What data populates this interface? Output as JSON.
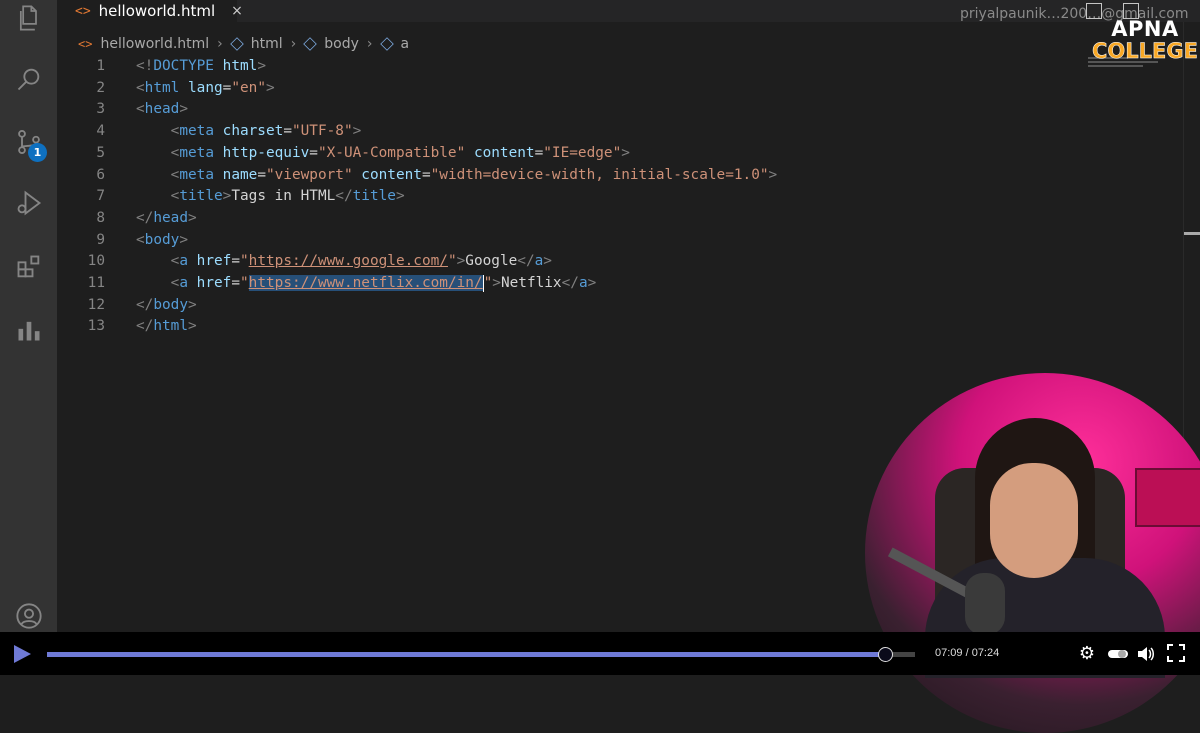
{
  "tab": {
    "file_icon": "<>",
    "filename": "helloworld.html",
    "close": "×"
  },
  "topright": {
    "text": "priyalpaunik…200…@gmail.com"
  },
  "breadcrumb": {
    "file_icon": "<>",
    "items": [
      "helloworld.html",
      "html",
      "body",
      "a"
    ]
  },
  "activity_bar": {
    "icons": [
      "explorer-icon",
      "search-icon",
      "source-control-icon",
      "run-debug-icon",
      "extensions-icon",
      "stats-icon",
      "account-icon"
    ],
    "source_control_badge": "1"
  },
  "logo": {
    "line1": "APNA",
    "line2": "COLLEGE"
  },
  "code_lines": [
    {
      "n": "1",
      "html": "<span class='bracket'>&lt;!</span><span class='tag'>DOCTYPE</span> <span class='attr'>html</span><span class='bracket'>&gt;</span>"
    },
    {
      "n": "2",
      "html": "<span class='bracket'>&lt;</span><span class='tag'>html</span> <span class='attr'>lang</span><span class='txt'>=</span><span class='str'>\"en\"</span><span class='bracket'>&gt;</span>"
    },
    {
      "n": "3",
      "html": "<span class='bracket'>&lt;</span><span class='tag'>head</span><span class='bracket'>&gt;</span>"
    },
    {
      "n": "4",
      "html": "    <span class='bracket'>&lt;</span><span class='tag'>meta</span> <span class='attr'>charset</span><span class='txt'>=</span><span class='str'>\"UTF-8\"</span><span class='bracket'>&gt;</span>"
    },
    {
      "n": "5",
      "html": "    <span class='bracket'>&lt;</span><span class='tag'>meta</span> <span class='attr'>http-equiv</span><span class='txt'>=</span><span class='str'>\"X-UA-Compatible\"</span> <span class='attr'>content</span><span class='txt'>=</span><span class='str'>\"IE=edge\"</span><span class='bracket'>&gt;</span>"
    },
    {
      "n": "6",
      "html": "    <span class='bracket'>&lt;</span><span class='tag'>meta</span> <span class='attr'>name</span><span class='txt'>=</span><span class='str'>\"viewport\"</span> <span class='attr'>content</span><span class='txt'>=</span><span class='str'>\"width=device-width, initial-scale=1.0\"</span><span class='bracket'>&gt;</span>"
    },
    {
      "n": "7",
      "html": "    <span class='bracket'>&lt;</span><span class='tag'>title</span><span class='bracket'>&gt;</span><span class='txt'>Tags in HTML</span><span class='bracket'>&lt;/</span><span class='tag'>title</span><span class='bracket'>&gt;</span>"
    },
    {
      "n": "8",
      "html": "<span class='bracket'>&lt;/</span><span class='tag'>head</span><span class='bracket'>&gt;</span>"
    },
    {
      "n": "9",
      "html": "<span class='bracket'>&lt;</span><span class='tag'>body</span><span class='bracket'>&gt;</span>"
    },
    {
      "n": "10",
      "html": "    <span class='bracket'>&lt;</span><span class='tag'>a</span> <span class='attr'>href</span><span class='txt'>=</span><span class='str'>\"<span class='link'>https://www.google.com/</span>\"</span><span class='bracket'>&gt;</span><span class='txt'>Google</span><span class='bracket'>&lt;/</span><span class='tag'>a</span><span class='bracket'>&gt;</span>"
    },
    {
      "n": "11",
      "html": "    <span class='bracket'>&lt;</span><span class='tag'>a</span> <span class='attr'>href</span><span class='txt'>=</span><span class='str'>\"<span class='link sel'>https://www.netflix.com/in/</span><span class='cursor'></span>\"</span><span class='bracket'>&gt;</span><span class='txt'>Netflix</span><span class='bracket'>&lt;/</span><span class='tag'>a</span><span class='bracket'>&gt;</span>"
    },
    {
      "n": "12",
      "html": "<span class='bracket'>&lt;/</span><span class='tag'>body</span><span class='bracket'>&gt;</span>"
    },
    {
      "n": "13",
      "html": "<span class='bracket'>&lt;/</span><span class='tag'>html</span><span class='bracket'>&gt;</span>"
    }
  ],
  "player": {
    "time": "07:09 / 07:24",
    "progress": 0.966,
    "controls": [
      "settings-icon",
      "toggle-icon",
      "volume-icon",
      "fullscreen-icon"
    ]
  }
}
